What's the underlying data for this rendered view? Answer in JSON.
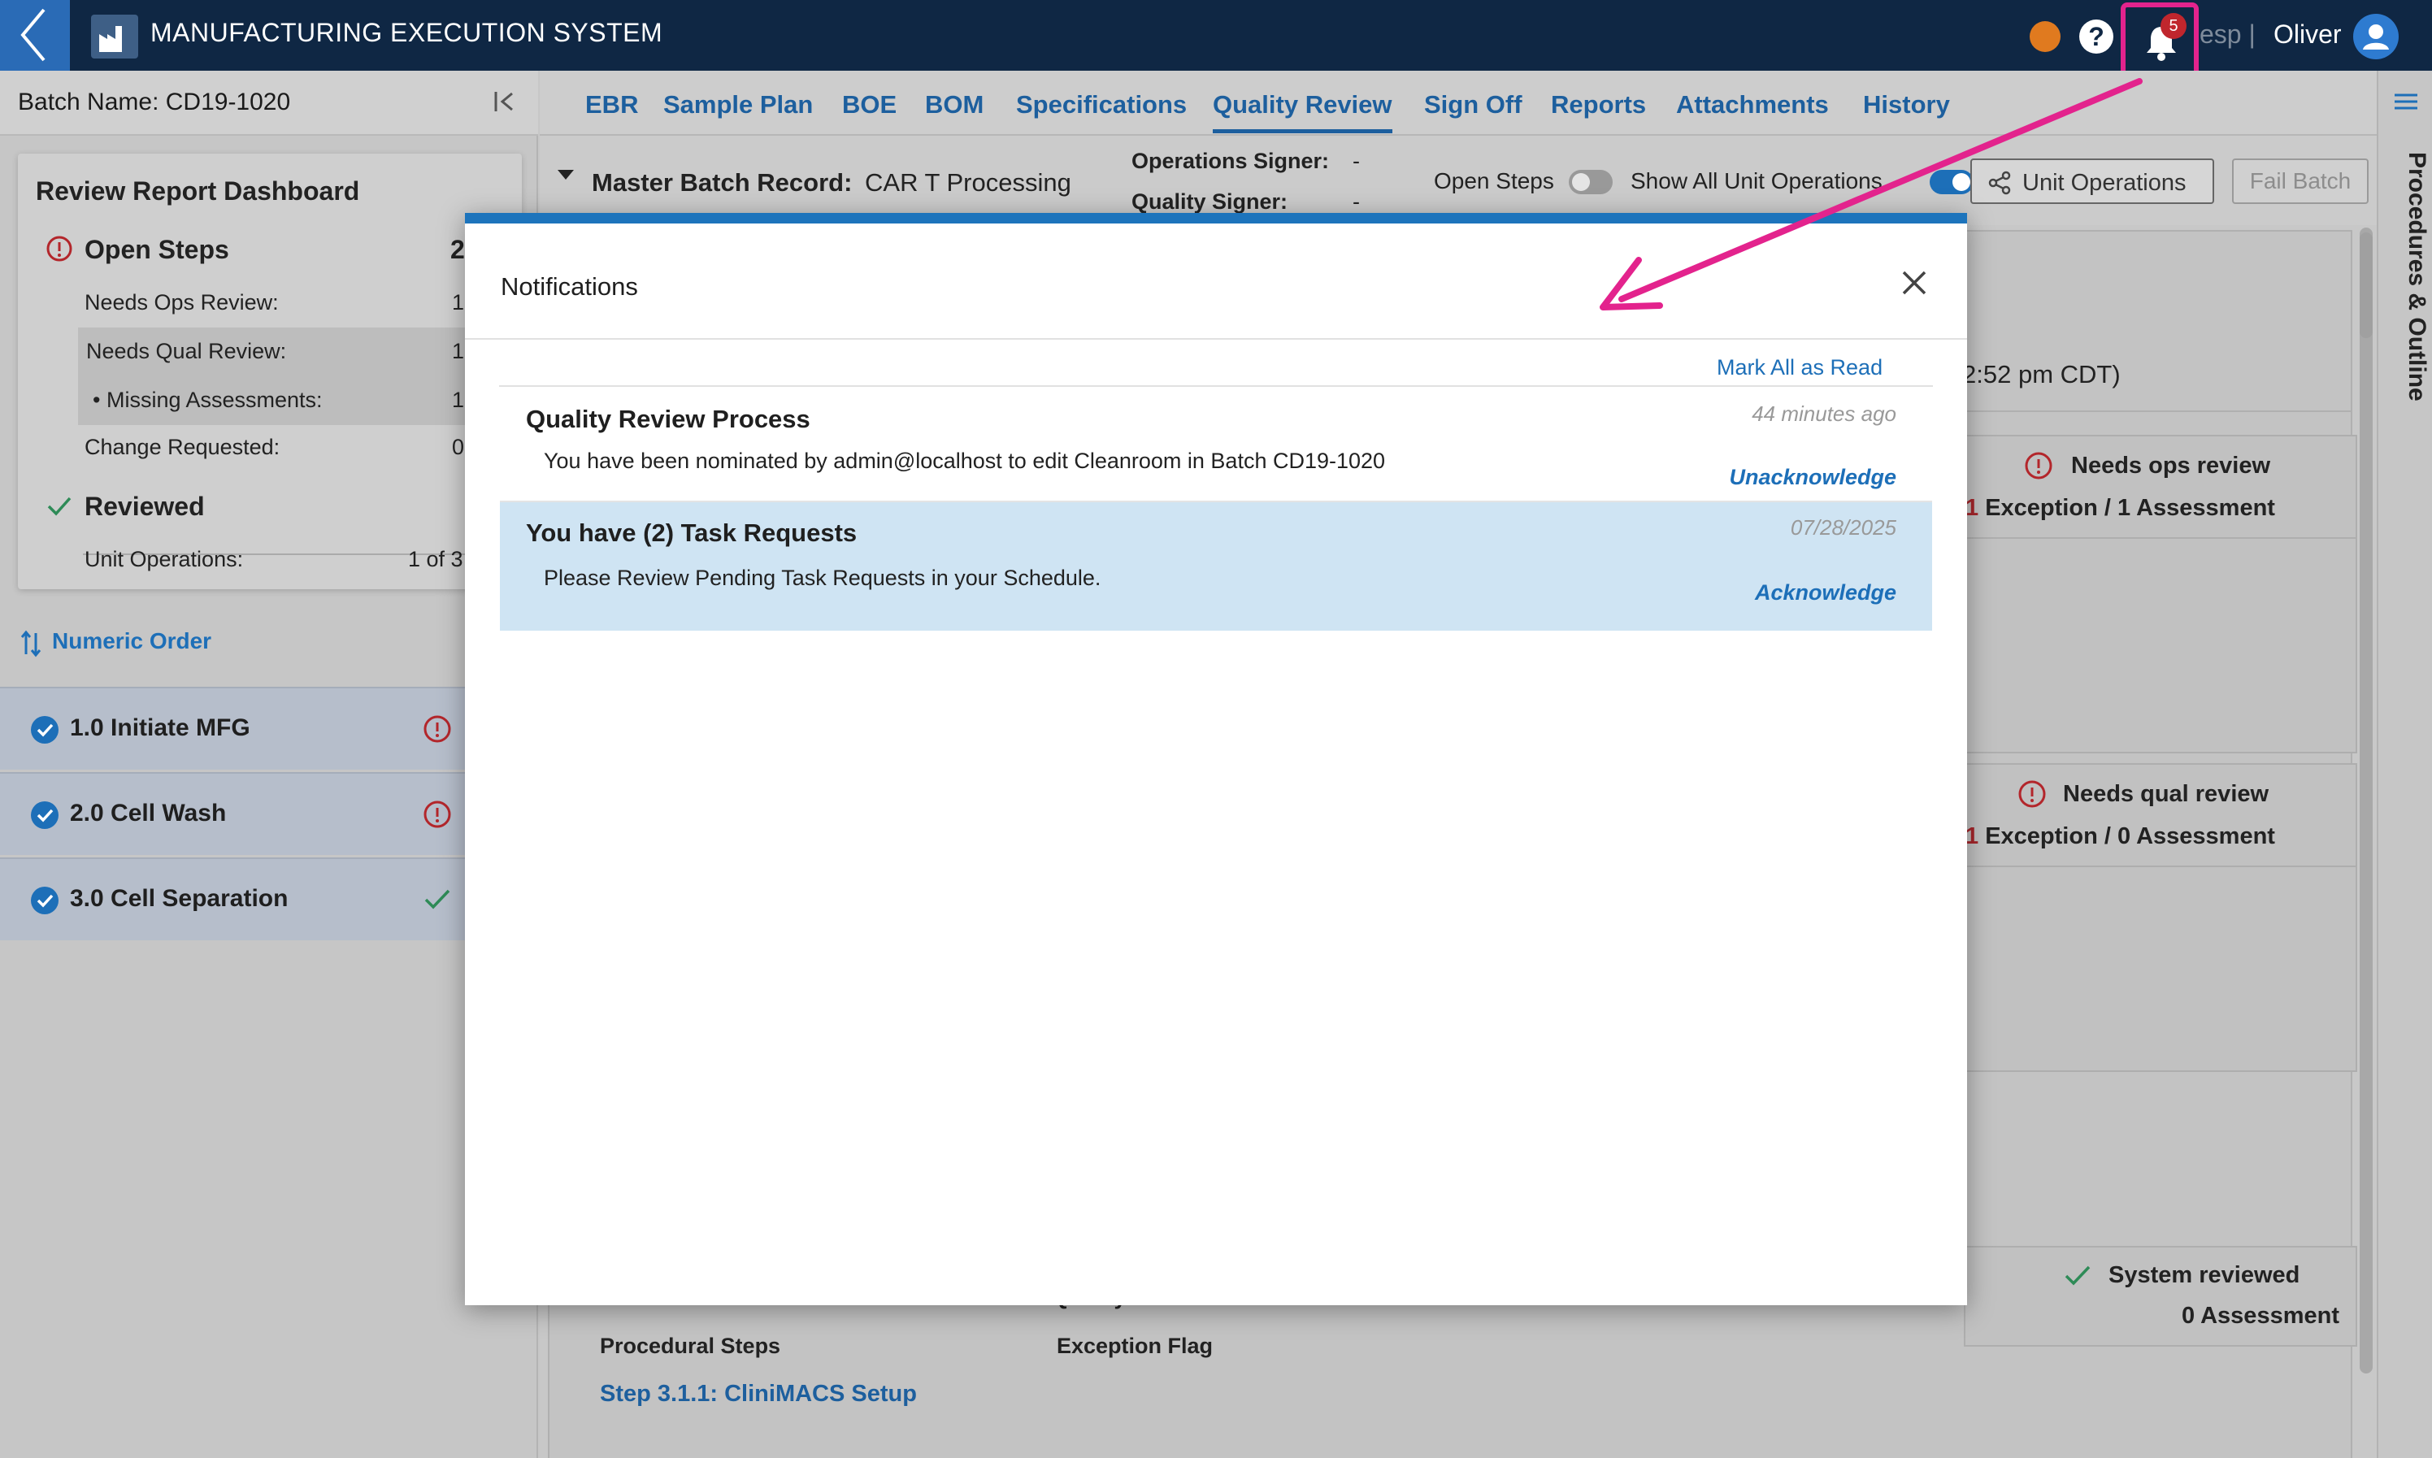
{
  "header": {
    "title": "MANUFACTURING EXECUTION SYSTEM",
    "notification_count": "5",
    "esp_label": "esp |",
    "user_name": "Oliver"
  },
  "left": {
    "batch_name": "Batch Name: CD19-1020",
    "dashboard": {
      "title": "Review Report Dashboard",
      "open_steps": {
        "label": "Open Steps",
        "count": "2"
      },
      "rows": [
        {
          "label": "Needs Ops Review:",
          "value": "1"
        },
        {
          "label": "Needs Qual Review:",
          "value": "1"
        },
        {
          "label": "• Missing Assessments:",
          "value": "1"
        },
        {
          "label": "Change Requested:",
          "value": "0"
        }
      ],
      "reviewed": {
        "label": "Reviewed"
      },
      "unit_ops": {
        "label": "Unit Operations:",
        "value": "1 of 3"
      }
    },
    "sort_label": "Numeric Order",
    "operations": [
      {
        "label": "1.0 Initiate MFG",
        "status": "alert"
      },
      {
        "label": "2.0 Cell Wash",
        "status": "alert"
      },
      {
        "label": "3.0 Cell Separation",
        "status": "check"
      }
    ]
  },
  "tabs": [
    "EBR",
    "Sample Plan",
    "BOE",
    "BOM",
    "Specifications",
    "Quality Review",
    "Sign Off",
    "Reports",
    "Attachments",
    "History"
  ],
  "active_tab": "Quality Review",
  "mbr": {
    "label": "Master Batch Record:",
    "value": "CAR T Processing",
    "ops_signer_label": "Operations Signer:",
    "ops_signer_value": "-",
    "qual_signer_label": "Quality Signer:",
    "qual_signer_value": "-",
    "open_steps_label": "Open Steps",
    "open_steps_on": false,
    "show_all_label": "Show All Unit Operations",
    "show_all_on": true,
    "unit_ops_button": "Unit Operations",
    "fail_batch_button": "Fail Batch"
  },
  "background": {
    "timestamp_fragment": "2:52 pm CDT)",
    "boxes": [
      {
        "title": "Needs ops review",
        "count": "1",
        "detail": "Exception / 1 Assessment",
        "icon": "alert-icon"
      },
      {
        "title": "Needs qual review",
        "count": "1",
        "detail": "Exception / 0 Assessment",
        "icon": "alert-icon"
      },
      {
        "title": "System reviewed",
        "count": "",
        "detail": "0 Assessment",
        "icon": "check-icon"
      }
    ],
    "quality_reviewer_label": "Quality Reviewer:",
    "procedural_steps_label": "Procedural Steps",
    "exception_flag_label": "Exception Flag",
    "step_link": "Step 3.1.1: CliniMACS Setup"
  },
  "right_panel_label": "Procedures & Outline",
  "modal": {
    "title": "Notifications",
    "mark_all": "Mark All as Read",
    "items": [
      {
        "title": "Quality Review Process",
        "time": "44 minutes ago",
        "message": "You have been nominated by admin@localhost to edit Cleanroom in Batch CD19-1020",
        "action": "Unacknowledge",
        "highlighted": false
      },
      {
        "title": "You have (2) Task Requests",
        "time": "07/28/2025",
        "message": "Please Review Pending Task Requests in your Schedule.",
        "action": "Acknowledge",
        "highlighted": true
      }
    ]
  },
  "colors": {
    "header_bg": "#0f2744",
    "accent_blue": "#1d74bc",
    "annotation_pink": "#e3238d",
    "alert_red": "#c0262d",
    "success_green": "#2e8b57"
  }
}
